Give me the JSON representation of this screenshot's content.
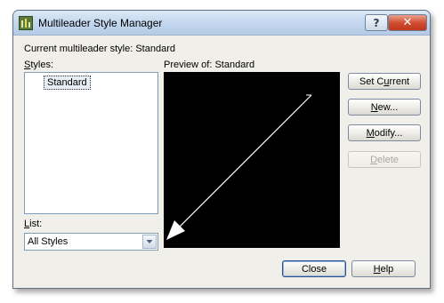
{
  "window": {
    "title": "Multileader Style Manager",
    "help_glyph": "?",
    "close_glyph": "✕"
  },
  "current_style": {
    "label": "Current multileader style: Standard"
  },
  "styles": {
    "label_accel": "S",
    "label_rest": "tyles:",
    "items": [
      "Standard"
    ],
    "selected": "Standard"
  },
  "list_filter": {
    "label_accel": "L",
    "label_rest": "ist:",
    "value": "All Styles",
    "arrow_icon": "chevron-down-icon"
  },
  "preview": {
    "label": "Preview of: Standard",
    "background": "#000000",
    "leader_color": "#ffffff"
  },
  "buttons": {
    "set_current": {
      "pre": "Set C",
      "accel": "u",
      "post": "rrent"
    },
    "new": {
      "pre": "",
      "accel": "N",
      "post": "ew..."
    },
    "modify": {
      "pre": "",
      "accel": "M",
      "post": "odify..."
    },
    "delete": {
      "pre": "",
      "accel": "D",
      "post": "elete"
    },
    "close": {
      "label": "Close"
    },
    "help": {
      "pre": "",
      "accel": "H",
      "post": "elp"
    }
  }
}
